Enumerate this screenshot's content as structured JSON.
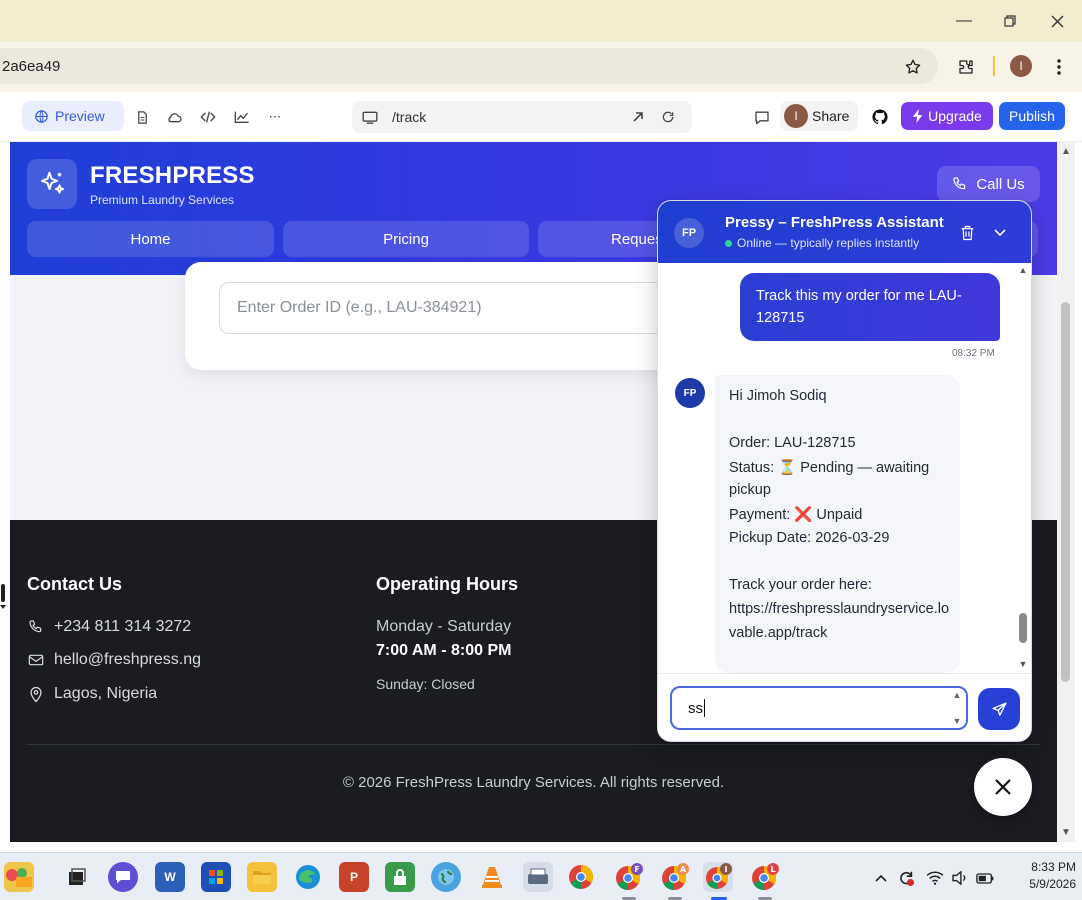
{
  "browser": {
    "url_fragment": "2a6ea49",
    "profile_initial": "I"
  },
  "toolbar": {
    "preview_label": "Preview",
    "route": "/track",
    "share_label": "Share",
    "share_avatar_initial": "I",
    "upgrade_label": "Upgrade",
    "publish_label": "Publish"
  },
  "site": {
    "brand_title": "FRESHPRESS",
    "brand_subtitle": "Premium Laundry Services",
    "call_label": "Call Us",
    "nav": [
      {
        "label": "Home"
      },
      {
        "label": "Pricing"
      },
      {
        "label": "Reques"
      }
    ],
    "order_placeholder": "Enter Order ID (e.g., LAU-384921)"
  },
  "footer": {
    "contact_heading": "Contact Us",
    "phone": "+234 811 314 3272",
    "email": "hello@freshpress.ng",
    "location": "Lagos, Nigeria",
    "hours_heading": "Operating Hours",
    "weekdays": "Monday - Saturday",
    "weekday_hours": "7:00 AM - 8:00 PM",
    "sunday": "Sunday: Closed",
    "copyright": "© 2026 FreshPress Laundry Services. All rights reserved."
  },
  "chat": {
    "avatar_initials": "FP",
    "title": "Pressy – FreshPress Assistant",
    "status": "Online — typically replies instantly",
    "user_message": "Track this my order for me LAU-128715",
    "user_time": "08:32 PM",
    "bot_lines": [
      "Hi Jimoh Sodiq",
      "Order: LAU-128715",
      "Status: ⏳ Pending — awaiting",
      "pickup",
      "Payment: ❌ Unpaid",
      "Pickup Date: 2026-03-29",
      "Track your order here:",
      "https://freshpresslaundryservice.lo",
      "vable.app/track"
    ],
    "input_value": "ss"
  },
  "taskbar": {
    "time": "8:33 PM",
    "date": "5/9/2026"
  },
  "colors": {
    "header_blue": "#1e3fd6",
    "upgrade_purple": "#7c3aed",
    "publish_blue": "#2563eb",
    "footer_dark": "#1a1c22"
  }
}
